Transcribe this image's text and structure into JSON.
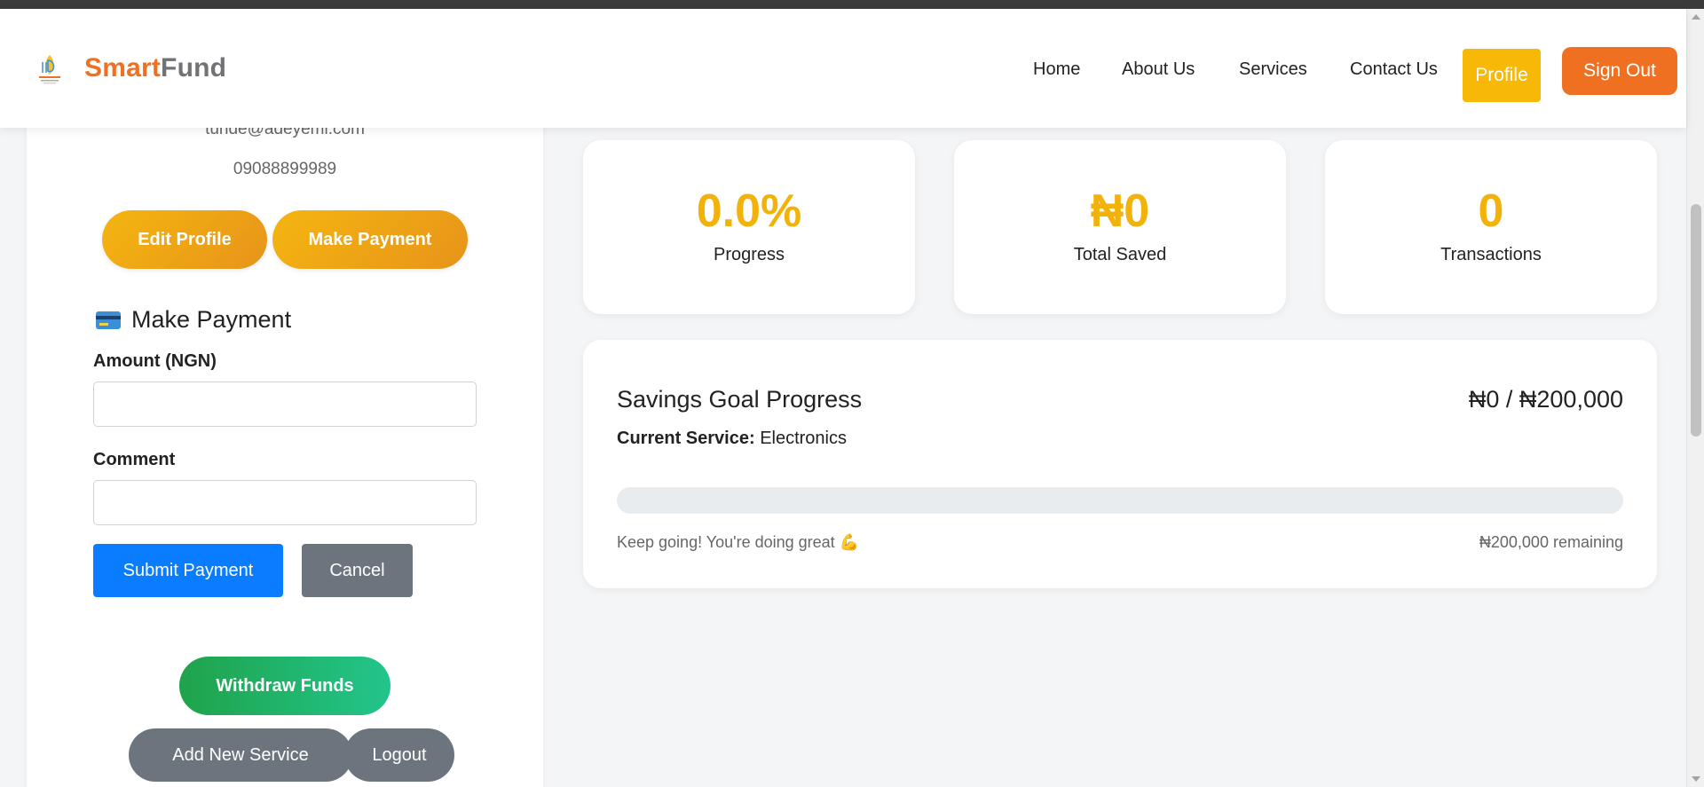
{
  "navbar": {
    "brand_part1": "Smart",
    "brand_part2": "Fund",
    "links": [
      "Home",
      "About Us",
      "Services",
      "Contact Us"
    ],
    "profile_label": "Profile",
    "signout_label": "Sign Out"
  },
  "sidebar": {
    "email": "tunde@adeyemi.com",
    "phone": "09088899989",
    "edit_profile_label": "Edit Profile",
    "make_payment_label": "Make Payment",
    "payment_form": {
      "title": "Make Payment",
      "title_icon": "credit-card-icon",
      "amount_label": "Amount (NGN)",
      "amount_value": "",
      "comment_label": "Comment",
      "comment_value": "",
      "submit_label": "Submit Payment",
      "cancel_label": "Cancel"
    },
    "withdraw_label": "Withdraw Funds",
    "add_service_label": "Add New Service",
    "logout_label": "Logout"
  },
  "stats": [
    {
      "value": "0.0%",
      "label": "Progress"
    },
    {
      "value": "₦0",
      "label": "Total Saved"
    },
    {
      "value": "0",
      "label": "Transactions"
    }
  ],
  "goal": {
    "title": "Savings Goal Progress",
    "amount": "₦0 / ₦200,000",
    "service_label": "Current Service:",
    "service_value": "Electronics",
    "progress_fraction": 0.0,
    "note": "Keep going! You're doing great 💪",
    "remaining": "₦200,000 remaining"
  },
  "colors": {
    "accent_orange": "#f07021",
    "accent_yellow": "#f2b20a",
    "primary_blue": "#0a7cff",
    "secondary_gray": "#6c757d",
    "success_green": "#1fa34a"
  }
}
